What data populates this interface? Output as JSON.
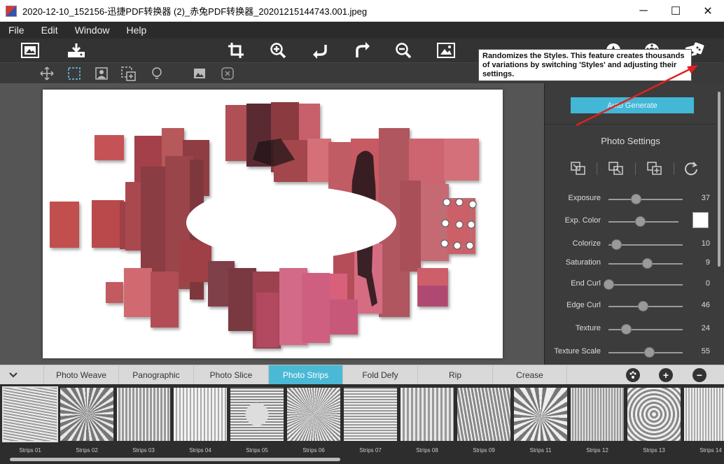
{
  "window": {
    "title": "2020-12-10_152156-迅捷PDF转换器 (2)_赤兔PDF转换器_20201215144743.001.jpeg",
    "minimize": "─",
    "maximize": "☐",
    "close": "✕"
  },
  "menu": [
    "File",
    "Edit",
    "Window",
    "Help"
  ],
  "toolbar": {
    "icons": [
      "open-photo-icon",
      "save-icon",
      "crop-icon",
      "zoom-in-icon",
      "undo-icon",
      "redo-icon",
      "zoom-out-icon",
      "fit-image-icon",
      "style-icon",
      "settings-icon",
      "randomize-dice-icon"
    ]
  },
  "subtoolbar": {
    "icons": [
      "move-icon",
      "select-icon",
      "portrait-icon",
      "add-region-icon",
      "light-icon",
      "image-icon",
      "remove-icon"
    ],
    "active": "select-icon"
  },
  "tooltip": {
    "text": "Randomizes the Styles. This feature creates thousands of variations by switching 'Styles' and adjusting their settings."
  },
  "panel": {
    "auto_generate": "Auto Generate",
    "title": "Photo Settings",
    "sliders": [
      {
        "label": "Exposure",
        "value": "37",
        "pos": 0.37
      },
      {
        "label": "Exp. Color",
        "value": "",
        "pos": 0.45
      },
      {
        "label": "Colorize",
        "value": "10",
        "pos": 0.1
      },
      {
        "label": "Saturation",
        "value": "9",
        "pos": 0.52
      },
      {
        "label": "End Curl",
        "value": "0",
        "pos": 0.0
      },
      {
        "label": "Edge Curl",
        "value": "46",
        "pos": 0.46
      },
      {
        "label": "Texture",
        "value": "24",
        "pos": 0.24
      },
      {
        "label": "Texture Scale",
        "value": "55",
        "pos": 0.55
      }
    ]
  },
  "tabs": {
    "items": [
      "Photo Weave",
      "Panographic",
      "Photo Slice",
      "Photo Strips",
      "Fold Defy",
      "Rip",
      "Crease"
    ],
    "active": "Photo Strips"
  },
  "thumbnails": [
    "Strips 01",
    "Strips 02",
    "Strips 03",
    "Strips 04",
    "Strips 05",
    "Strips 06",
    "Strips 07",
    "Strips 08",
    "Strips 09",
    "Strips 11",
    "Strips 12",
    "Strips 13",
    "Strips 14"
  ],
  "colors": {
    "accent": "#43b7d6",
    "photo_red": "#c0504d",
    "photo_pink": "#d9607a"
  }
}
